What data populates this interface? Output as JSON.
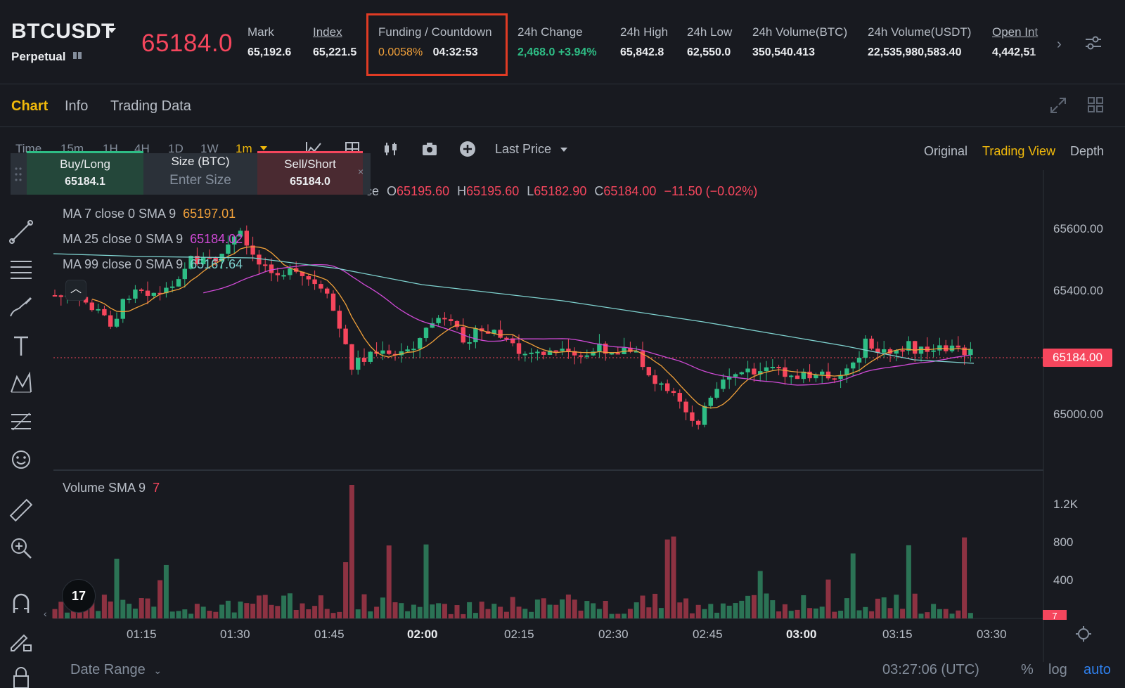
{
  "ticker": {
    "symbol": "BTCUSDT",
    "contract_type": "Perpetual",
    "last_price": "65184.0",
    "stats": [
      {
        "label": "Mark",
        "value": "65,192.6",
        "underline": false
      },
      {
        "label": "Index",
        "value": "65,221.5",
        "underline": true
      },
      {
        "label": "Funding / Countdown",
        "value": "0.0058%",
        "value2": "04:32:53"
      },
      {
        "label": "24h Change",
        "value": "2,468.0 +3.94%"
      },
      {
        "label": "24h High",
        "value": "65,842.8"
      },
      {
        "label": "24h Low",
        "value": "62,550.0"
      },
      {
        "label": "24h Volume(BTC)",
        "value": "350,540.413"
      },
      {
        "label": "24h Volume(USDT)",
        "value": "22,535,980,583.40"
      },
      {
        "label": "Open Int",
        "value": "4,442,51"
      }
    ],
    "colors": {
      "price_down": "#f6465d",
      "price_up": "#2ebd85",
      "funding": "#f0b90b",
      "highlight_box": "#e03b24"
    }
  },
  "tabs": [
    {
      "label": "Chart",
      "active": true
    },
    {
      "label": "Info",
      "active": false
    },
    {
      "label": "Trading Data",
      "active": false
    }
  ],
  "toolbar": {
    "timeframes": [
      "Time",
      "15m",
      "1H",
      "4H",
      "1D",
      "1W",
      "1m"
    ],
    "active_timeframe": "1m",
    "price_source": "Last Price",
    "views": [
      "Original",
      "Trading View",
      "Depth"
    ],
    "active_view": "Trading View"
  },
  "order_panel": {
    "buy_label": "Buy/Long",
    "buy_price": "65184.1",
    "size_label": "Size (BTC)",
    "size_placeholder": "Enter Size",
    "sell_label": "Sell/Short",
    "sell_price": "65184.0",
    "close": "×"
  },
  "chart": {
    "ohlc": {
      "o": "65195.60",
      "h": "65195.60",
      "l": "65182.90",
      "c": "65184.00",
      "change": "−11.50 (−0.02%)",
      "title_tail": "ce"
    },
    "indicators": [
      {
        "label": "MA 7 close 0 SMA 9",
        "value": "65197.01",
        "color": "#f0a03a"
      },
      {
        "label": "MA 25 close 0 SMA 9",
        "value": "65184.02",
        "color": "#d04ad6"
      },
      {
        "label": "MA 99 close 0 SMA 9",
        "value": "65167.64",
        "color": "#7fd3d0"
      }
    ],
    "price_axis": [
      "65600.00",
      "65400.00",
      "65000.00"
    ],
    "current_price_tag": "65184.00",
    "volume_label": "Volume SMA 9",
    "volume_value": "7",
    "volume_axis": [
      "1.2K",
      "800",
      "400"
    ],
    "volume_tag": "7",
    "time_axis": [
      {
        "label": "01:15",
        "bold": false
      },
      {
        "label": "01:30",
        "bold": false
      },
      {
        "label": "01:45",
        "bold": false
      },
      {
        "label": "02:00",
        "bold": true
      },
      {
        "label": "02:15",
        "bold": false
      },
      {
        "label": "02:30",
        "bold": false
      },
      {
        "label": "02:45",
        "bold": false
      },
      {
        "label": "03:00",
        "bold": true
      },
      {
        "label": "03:15",
        "bold": false
      },
      {
        "label": "03:30",
        "bold": false
      }
    ],
    "tv_logo": "17"
  },
  "footer": {
    "date_range": "Date Range",
    "utc_time": "03:27:06 (UTC)",
    "percent": "%",
    "log": "log",
    "auto": "auto"
  },
  "icons": [
    "chevron-down-icon",
    "book-icon",
    "chevron-right-icon",
    "settings-sliders-icon",
    "expand-icon",
    "grid-layout-icon",
    "indicator-icon",
    "template-icon",
    "candles-icon",
    "camera-icon",
    "plus-circle-icon",
    "crosshair-icon",
    "trendline-icon",
    "horizontal-lines-icon",
    "brush-icon",
    "text-icon",
    "pattern-icon",
    "fib-icon",
    "emoji-icon",
    "ruler-icon",
    "zoom-in-icon",
    "magnet-icon",
    "pencil-lock-icon",
    "lock-icon",
    "clock-settings-icon"
  ]
}
